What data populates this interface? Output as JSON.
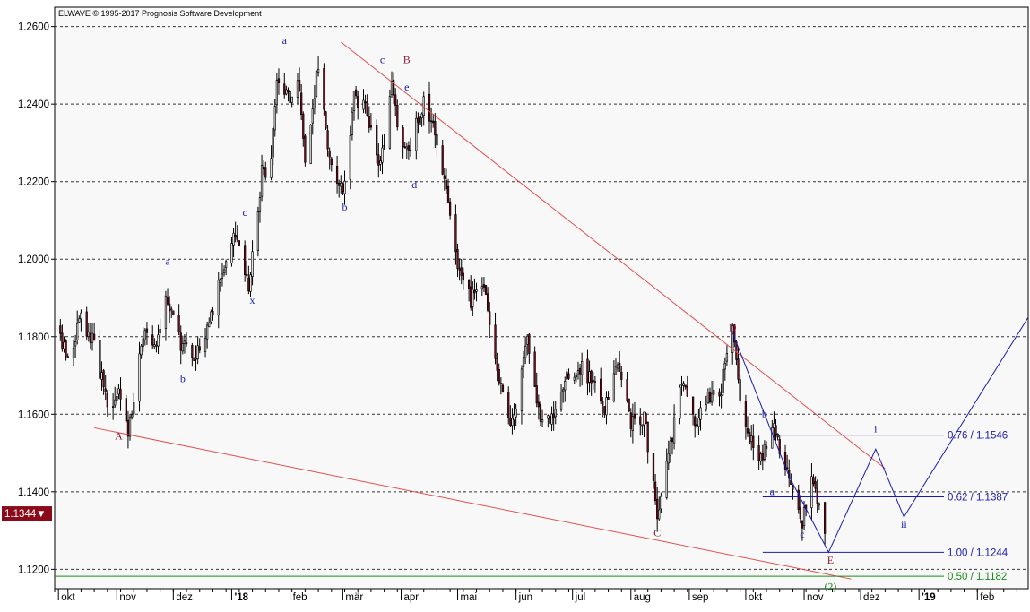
{
  "chart_data": {
    "type": "candlestick",
    "copyright": "ELWAVE © 1995-2017 Prognosis Software Development",
    "current_price": "1.1344",
    "y_range": [
      1.115,
      1.265
    ],
    "y_ticks": [
      "1.2600",
      "1.2400",
      "1.2200",
      "1.2000",
      "1.1800",
      "1.1600",
      "1.1400",
      "1.1200"
    ],
    "x_start": "2017-09-29",
    "x_end": "2019-02-28",
    "x_ticks": [
      {
        "label": "okt",
        "date": "2017-10-01",
        "bold": false
      },
      {
        "label": "nov",
        "date": "2017-11-01",
        "bold": false
      },
      {
        "label": "dez",
        "date": "2017-12-01",
        "bold": false
      },
      {
        "label": "'18",
        "date": "2018-01-01",
        "bold": true
      },
      {
        "label": "feb",
        "date": "2018-02-01",
        "bold": false
      },
      {
        "label": "mär",
        "date": "2018-03-01",
        "bold": false
      },
      {
        "label": "apr",
        "date": "2018-04-01",
        "bold": false
      },
      {
        "label": "mai",
        "date": "2018-05-01",
        "bold": false
      },
      {
        "label": "jun",
        "date": "2018-06-01",
        "bold": false
      },
      {
        "label": "jul",
        "date": "2018-07-01",
        "bold": false
      },
      {
        "label": "aug",
        "date": "2018-08-01",
        "bold": false
      },
      {
        "label": "sep",
        "date": "2018-09-01",
        "bold": false
      },
      {
        "label": "okt",
        "date": "2018-10-01",
        "bold": false
      },
      {
        "label": "nov",
        "date": "2018-11-01",
        "bold": false
      },
      {
        "label": "dez",
        "date": "2018-12-01",
        "bold": false
      },
      {
        "label": "'19",
        "date": "2019-01-01",
        "bold": true
      },
      {
        "label": "feb",
        "date": "2019-02-01",
        "bold": false
      }
    ],
    "price_path": [
      [
        "2017-10-01",
        1.18
      ],
      [
        "2017-10-06",
        1.174
      ],
      [
        "2017-10-13",
        1.185
      ],
      [
        "2017-10-20",
        1.178
      ],
      [
        "2017-10-27",
        1.162
      ],
      [
        "2017-11-03",
        1.165
      ],
      [
        "2017-11-07",
        1.155
      ],
      [
        "2017-11-15",
        1.18
      ],
      [
        "2017-11-22",
        1.176
      ],
      [
        "2017-11-27",
        1.19
      ],
      [
        "2017-12-05",
        1.178
      ],
      [
        "2017-12-12",
        1.175
      ],
      [
        "2017-12-20",
        1.184
      ],
      [
        "2017-12-29",
        1.2
      ],
      [
        "2018-01-03",
        1.206
      ],
      [
        "2018-01-08",
        1.196
      ],
      [
        "2018-01-10",
        1.192
      ],
      [
        "2018-01-17",
        1.222
      ],
      [
        "2018-01-22",
        1.225
      ],
      [
        "2018-01-25",
        1.248
      ],
      [
        "2018-01-31",
        1.241
      ],
      [
        "2018-02-05",
        1.247
      ],
      [
        "2018-02-09",
        1.227
      ],
      [
        "2018-02-16",
        1.25
      ],
      [
        "2018-02-21",
        1.23
      ],
      [
        "2018-03-01",
        1.216
      ],
      [
        "2018-03-07",
        1.242
      ],
      [
        "2018-03-13",
        1.24
      ],
      [
        "2018-03-21",
        1.224
      ],
      [
        "2018-03-27",
        1.245
      ],
      [
        "2018-04-02",
        1.227
      ],
      [
        "2018-04-06",
        1.23
      ],
      [
        "2018-04-13",
        1.24
      ],
      [
        "2018-04-17",
        1.236
      ],
      [
        "2018-04-24",
        1.222
      ],
      [
        "2018-05-01",
        1.197
      ],
      [
        "2018-05-08",
        1.189
      ],
      [
        "2018-05-14",
        1.195
      ],
      [
        "2018-05-22",
        1.171
      ],
      [
        "2018-05-29",
        1.155
      ],
      [
        "2018-06-07",
        1.18
      ],
      [
        "2018-06-14",
        1.157
      ],
      [
        "2018-06-21",
        1.161
      ],
      [
        "2018-06-28",
        1.169
      ],
      [
        "2018-07-06",
        1.172
      ],
      [
        "2018-07-12",
        1.168
      ],
      [
        "2018-07-18",
        1.162
      ],
      [
        "2018-07-25",
        1.172
      ],
      [
        "2018-08-01",
        1.158
      ],
      [
        "2018-08-08",
        1.159
      ],
      [
        "2018-08-15",
        1.134
      ],
      [
        "2018-08-21",
        1.15
      ],
      [
        "2018-08-28",
        1.168
      ],
      [
        "2018-09-04",
        1.158
      ],
      [
        "2018-09-11",
        1.164
      ],
      [
        "2018-09-18",
        1.167
      ],
      [
        "2018-09-24",
        1.181
      ],
      [
        "2018-09-28",
        1.163
      ],
      [
        "2018-10-02",
        1.155
      ],
      [
        "2018-10-09",
        1.149
      ],
      [
        "2018-10-16",
        1.158
      ],
      [
        "2018-10-22",
        1.146
      ],
      [
        "2018-10-26",
        1.139
      ],
      [
        "2018-10-31",
        1.132
      ],
      [
        "2018-11-05",
        1.142
      ],
      [
        "2018-11-08",
        1.137
      ],
      [
        "2018-11-12",
        1.131
      ]
    ],
    "trendlines_red": [
      {
        "from": [
          "2017-10-20",
          1.1565
        ],
        "to": [
          "2018-11-26",
          1.1175
        ]
      },
      {
        "from": [
          "2018-02-28",
          1.256
        ],
        "to": [
          "2018-12-14",
          1.146
        ]
      }
    ],
    "projection_path": [
      [
        "2018-09-24",
        1.181
      ],
      [
        "2018-10-24",
        1.144
      ],
      [
        "2018-11-14",
        1.1244
      ],
      [
        "2018-12-09",
        1.151
      ],
      [
        "2018-12-24",
        1.1335
      ],
      [
        "2019-02-28",
        1.185
      ]
    ],
    "fib_levels": [
      {
        "label": "0.76 / 1.1546",
        "value": 1.1546,
        "from": "2018-10-18",
        "color": "#1a1ab0"
      },
      {
        "label": "0.62 / 1.1387",
        "value": 1.1387,
        "from": "2018-10-10",
        "color": "#1a1ab0"
      },
      {
        "label": "1.00 / 1.1244",
        "value": 1.1244,
        "from": "2018-10-10",
        "color": "#1a1ab0"
      },
      {
        "label": "0.50 / 1.1182",
        "value": 1.1182,
        "from": "2017-09-29",
        "color": "#1a8a1a"
      }
    ],
    "wave_labels": [
      {
        "text": "A",
        "date": "2017-11-02",
        "value": 1.1535,
        "color": "#8b1a3a"
      },
      {
        "text": "a",
        "date": "2017-11-28",
        "value": 1.1985,
        "color": "#1a1ab0"
      },
      {
        "text": "b",
        "date": "2017-12-06",
        "value": 1.1683,
        "color": "#1a1ab0"
      },
      {
        "text": "c",
        "date": "2018-01-08",
        "value": 1.2112,
        "color": "#1a1ab0"
      },
      {
        "text": "x",
        "date": "2018-01-12",
        "value": 1.1885,
        "color": "#1a1ab0"
      },
      {
        "text": "a",
        "date": "2018-01-29",
        "value": 1.2555,
        "color": "#1a1ab0"
      },
      {
        "text": "b",
        "date": "2018-03-02",
        "value": 1.2125,
        "color": "#1a1ab0"
      },
      {
        "text": "c",
        "date": "2018-03-22",
        "value": 1.2505,
        "color": "#1a1ab0"
      },
      {
        "text": "B",
        "date": "2018-04-04",
        "value": 1.2505,
        "color": "#8b1a3a"
      },
      {
        "text": "e",
        "date": "2018-04-04",
        "value": 1.2435,
        "color": "#1a1ab0"
      },
      {
        "text": "d",
        "date": "2018-04-08",
        "value": 1.2183,
        "color": "#1a1ab0"
      },
      {
        "text": "C",
        "date": "2018-08-15",
        "value": 1.1285,
        "color": "#8b1a3a"
      },
      {
        "text": "D",
        "date": "2018-09-24",
        "value": 1.1815,
        "color": "#8b1a3a"
      },
      {
        "text": "b",
        "date": "2018-10-11",
        "value": 1.1592,
        "color": "#1a1ab0"
      },
      {
        "text": "a",
        "date": "2018-10-15",
        "value": 1.1392,
        "color": "#1a1ab0"
      },
      {
        "text": "c",
        "date": "2018-10-31",
        "value": 1.1282,
        "color": "#1a1ab0"
      },
      {
        "text": "E",
        "date": "2018-11-15",
        "value": 1.1215,
        "color": "#8b1a3a"
      },
      {
        "text": "(2)",
        "date": "2018-11-15",
        "value": 1.1147,
        "color": "#1a8a1a"
      },
      {
        "text": "i",
        "date": "2018-12-09",
        "value": 1.1553,
        "color": "#1a1ab0"
      },
      {
        "text": "ii",
        "date": "2018-12-24",
        "value": 1.1307,
        "color": "#1a1ab0"
      }
    ]
  }
}
